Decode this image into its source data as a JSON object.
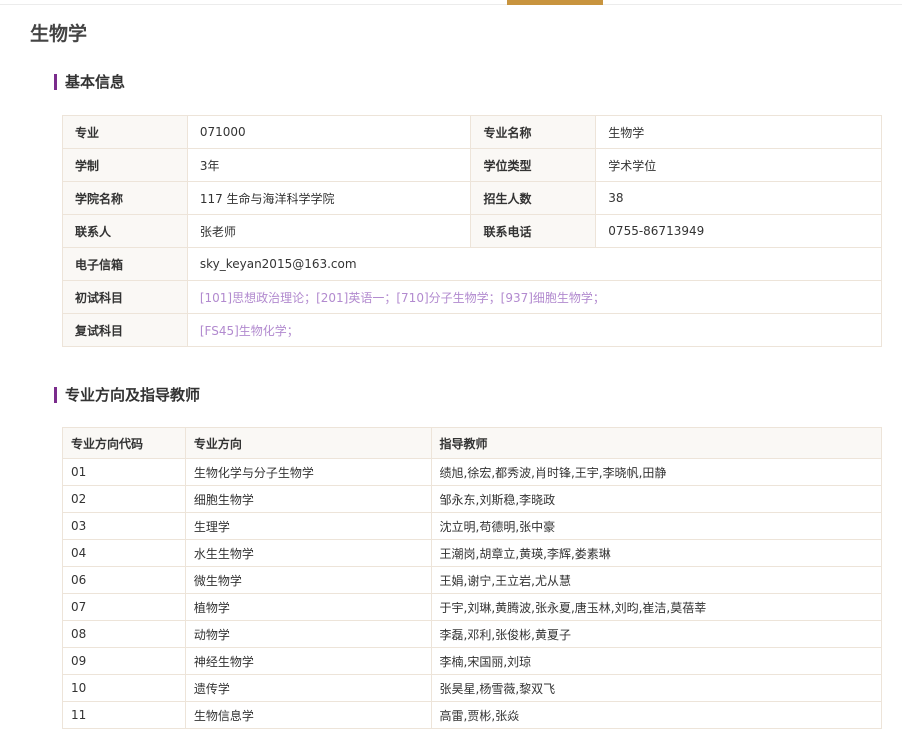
{
  "page": {
    "title": "生物学"
  },
  "sections": {
    "basic": "基本信息",
    "directions": "专业方向及指导教师"
  },
  "info": {
    "major_label": "专业",
    "major_value": "071000",
    "name_label": "专业名称",
    "name_value": "生物学",
    "duration_label": "学制",
    "duration_value": "3年",
    "degree_label": "学位类型",
    "degree_value": "学术学位",
    "college_label": "学院名称",
    "college_value": "117 生命与海洋科学学院",
    "enroll_label": "招生人数",
    "enroll_value": "38",
    "contact_label": "联系人",
    "contact_value": "张老师",
    "phone_label": "联系电话",
    "phone_value": "0755-86713949",
    "email_label": "电子信箱",
    "email_value": "sky_keyan2015@163.com",
    "exam_label": "初试科目",
    "exam_value": "[101]思想政治理论；[201]英语一；[710]分子生物学；[937]细胞生物学；",
    "retest_label": "复试科目",
    "retest_value": "[FS45]生物化学；"
  },
  "directions": {
    "headers": [
      "专业方向代码",
      "专业方向",
      "指导教师"
    ],
    "rows": [
      [
        "01",
        "生物化学与分子生物学",
        "绩旭,徐宏,都秀波,肖时锋,王宇,李晓帆,田静"
      ],
      [
        "02",
        "细胞生物学",
        "邹永东,刘斯稳,李晓政"
      ],
      [
        "03",
        "生理学",
        "沈立明,苟德明,张中豪"
      ],
      [
        "04",
        "水生生物学",
        "王潮岗,胡章立,黄瑛,李辉,娄素琳"
      ],
      [
        "06",
        "微生物学",
        "王娟,谢宁,王立岩,尤从慧"
      ],
      [
        "07",
        "植物学",
        "于宇,刘琳,黄腾波,张永夏,唐玉林,刘昀,崔洁,莫蓓莘"
      ],
      [
        "08",
        "动物学",
        "李磊,邓利,张俊彬,黄夏子"
      ],
      [
        "09",
        "神经生物学",
        "李楠,宋国丽,刘琼"
      ],
      [
        "10",
        "遗传学",
        "张昊星,杨雪薇,黎双飞"
      ],
      [
        "11",
        "生物信息学",
        "高雷,贾彬,张焱"
      ]
    ]
  },
  "colors": {
    "accent_bar": "#7a2c8c",
    "tab_indicator": "#c8943e",
    "link_text": "#b28acf",
    "border": "#ede4d9",
    "label_bg": "#faf8f5"
  }
}
